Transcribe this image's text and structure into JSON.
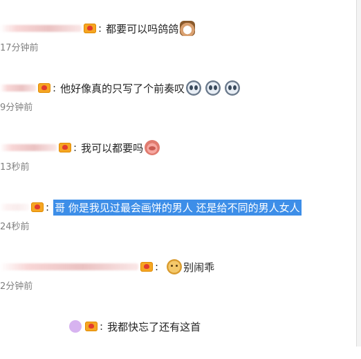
{
  "comments": [
    {
      "text": "都要可以吗鸽鸽",
      "time": "17分钟前",
      "emojis": [
        "cat-emoji"
      ]
    },
    {
      "text": "他好像真的只写了个前奏叹",
      "time": "9分钟前",
      "emojis": [
        "cry-emoji",
        "cry-emoji",
        "cry-emoji"
      ]
    },
    {
      "text": "我可以都要吗",
      "time": "13秒前",
      "emojis": [
        "pig-emoji"
      ]
    },
    {
      "text": "哥 你是我见过最会画饼的男人 还是给不同的男人女人",
      "time": "24秒前",
      "emojis": [],
      "selected": true
    },
    {
      "text": "别闹乖",
      "time": "2分钟前",
      "emojis": [
        "dog-emoji"
      ]
    },
    {
      "text": "我都快忘了还有这首",
      "time": "",
      "emojis": []
    }
  ],
  "colon": ":",
  "colors": {
    "highlight": "#3d8ee8",
    "time": "#808080",
    "badge": "#f5a623"
  }
}
